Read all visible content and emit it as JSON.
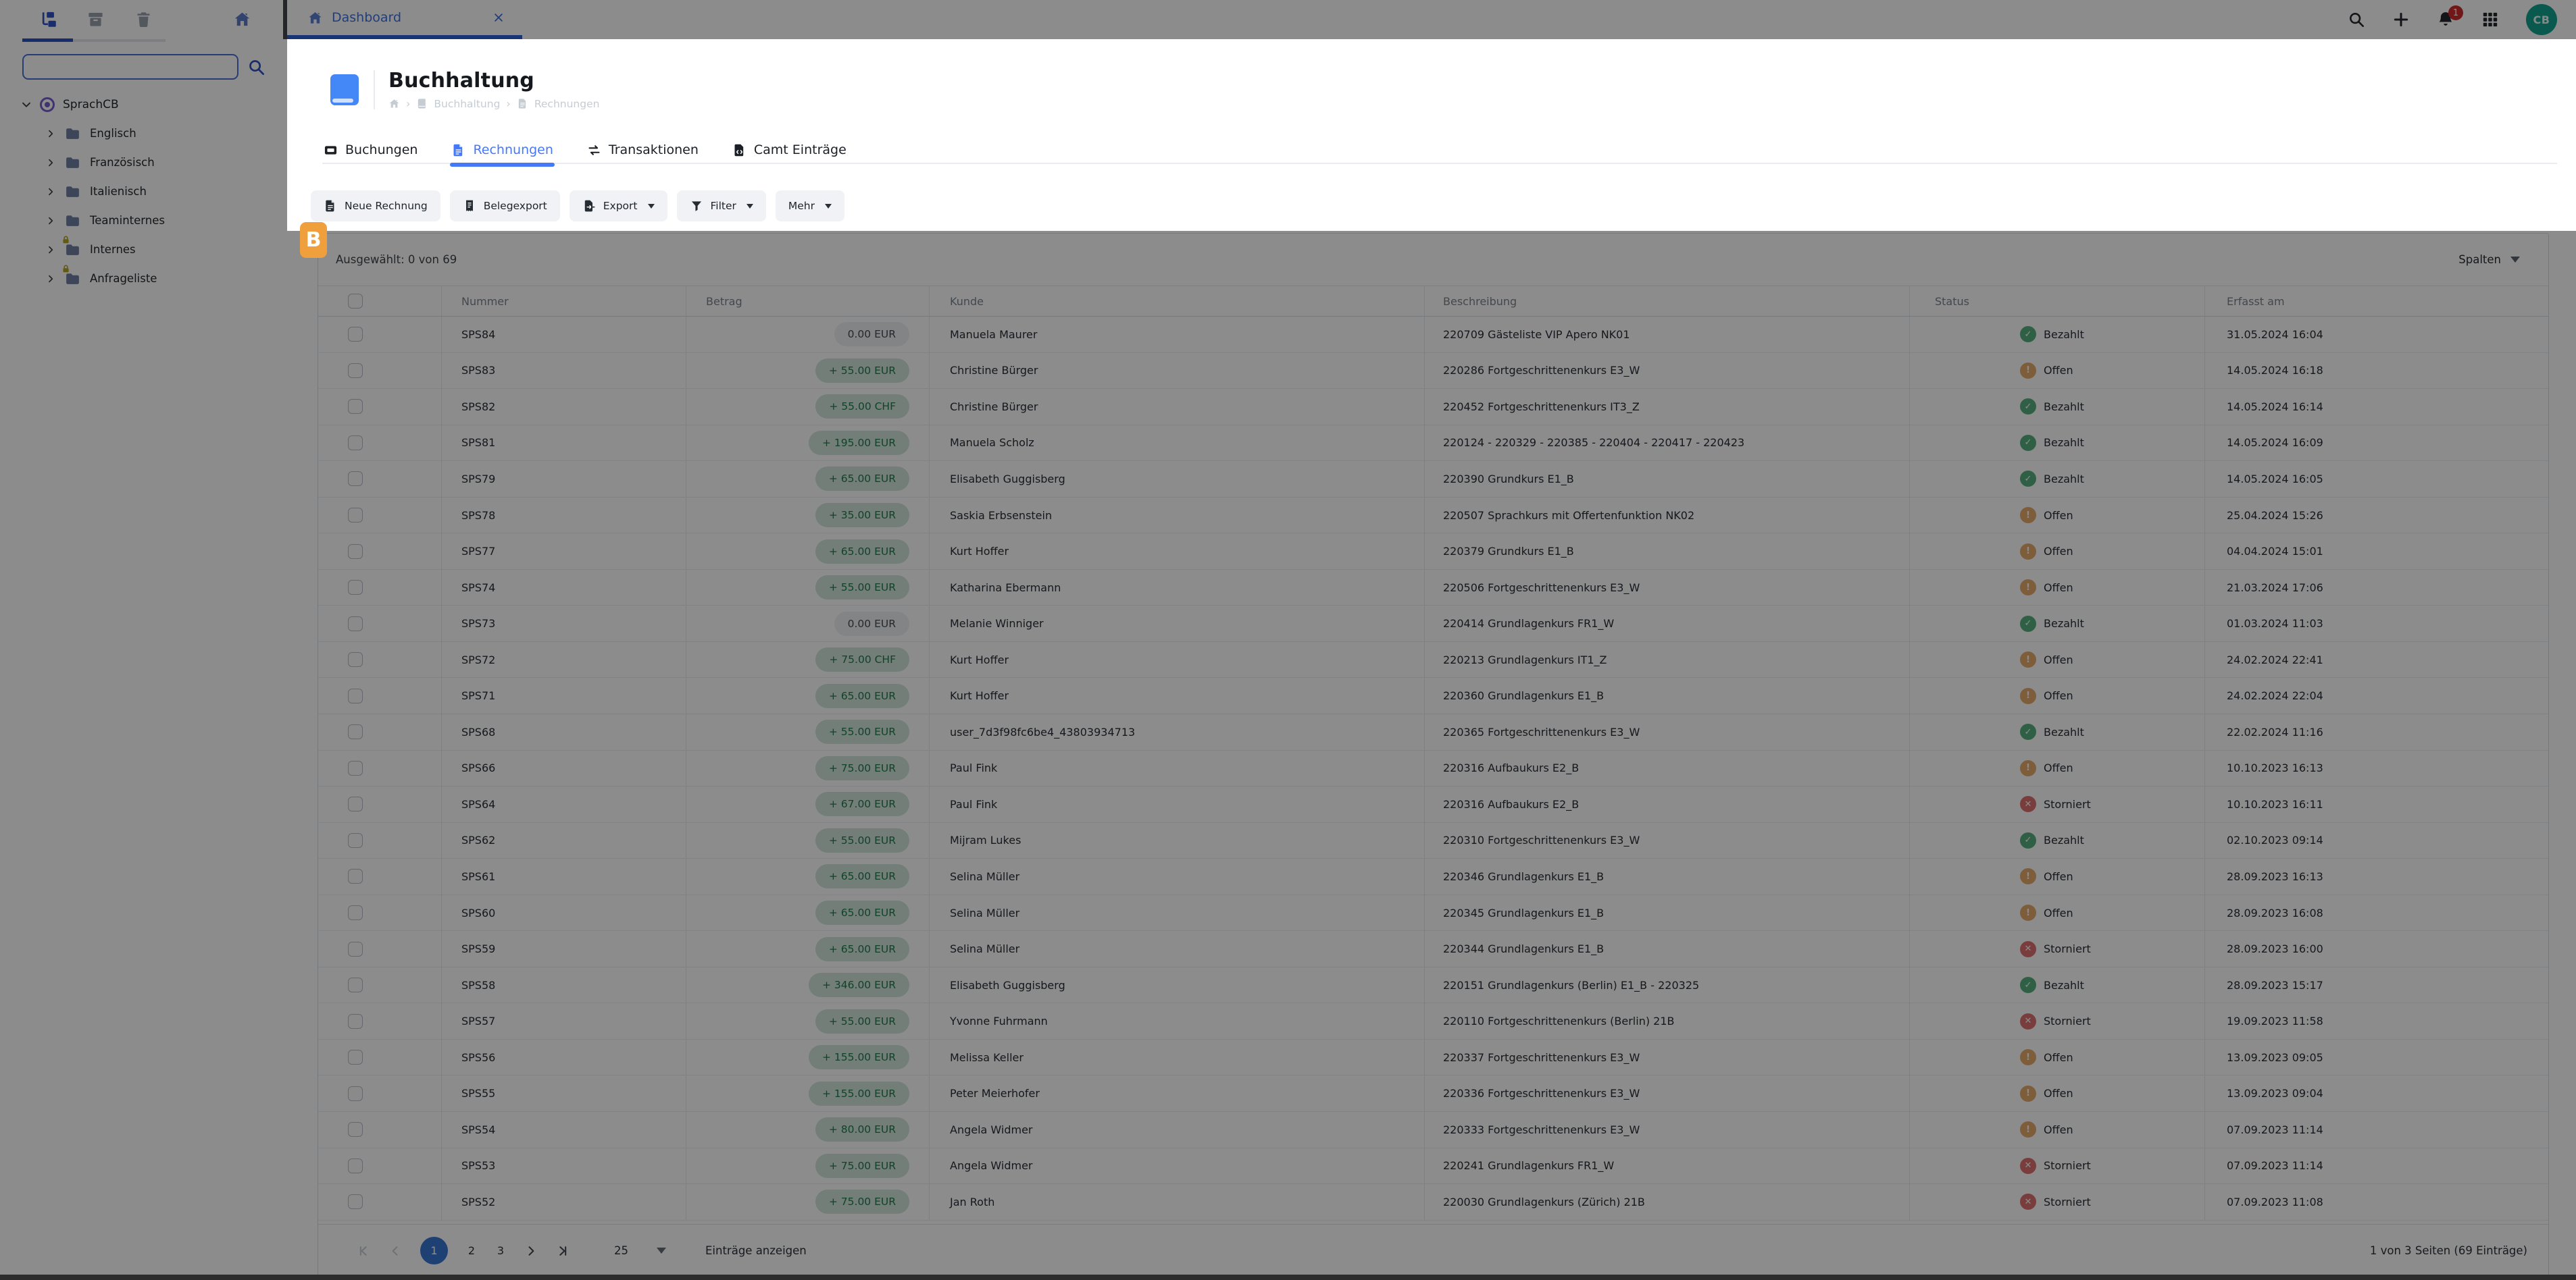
{
  "topbar": {
    "tab": {
      "label": "Dashboard"
    },
    "action_icons": [
      "search",
      "add",
      "notifications",
      "apps"
    ],
    "notification_count": "1",
    "avatar": "CB"
  },
  "sidebar": {
    "toolbar_icons": [
      "tree-structure",
      "archive",
      "trash",
      "home"
    ],
    "search": {
      "value": "",
      "placeholder": ""
    },
    "tree": {
      "root": {
        "label": "SprachCB"
      },
      "items": [
        {
          "label": "Englisch",
          "locked": false
        },
        {
          "label": "Französisch",
          "locked": false
        },
        {
          "label": "Italienisch",
          "locked": false
        },
        {
          "label": "Teaminternes",
          "locked": false
        },
        {
          "label": "Internes",
          "locked": true
        },
        {
          "label": "Anfrageliste",
          "locked": true
        }
      ]
    }
  },
  "page": {
    "title": "Buchhaltung",
    "breadcrumb": [
      "Buchhaltung",
      "Rechnungen"
    ],
    "breadcrumb_separator": "›"
  },
  "tabs": [
    {
      "label": "Buchungen",
      "icon": "ticket",
      "active": false
    },
    {
      "label": "Rechnungen",
      "icon": "invoice",
      "active": true
    },
    {
      "label": "Transaktionen",
      "icon": "transfer",
      "active": false
    },
    {
      "label": "Camt Einträge",
      "icon": "file-code",
      "active": false
    }
  ],
  "toolbar": [
    {
      "label": "Neue Rechnung",
      "icon": "invoice",
      "dropdown": false
    },
    {
      "label": "Belegexport",
      "icon": "receipt",
      "dropdown": false
    },
    {
      "label": "Export",
      "icon": "export",
      "dropdown": true
    },
    {
      "label": "Filter",
      "icon": "funnel",
      "dropdown": true
    },
    {
      "label": "Mehr",
      "icon": "",
      "dropdown": true
    }
  ],
  "panel": {
    "selected_summary": "Ausgewählt: 0 von 69",
    "columns_button": "Spalten"
  },
  "table": {
    "headers": [
      "Nummer",
      "Betrag",
      "Kunde",
      "Beschreibung",
      "Status",
      "Erfasst am"
    ],
    "rows": [
      {
        "nummer": "SPS84",
        "betrag": "0.00 EUR",
        "kind": "zero",
        "kunde": "Manuela Maurer",
        "beschreibung": "220709 Gästeliste VIP Apero NK01",
        "status": "Bezahlt",
        "erfasst": "31.05.2024 16:04"
      },
      {
        "nummer": "SPS83",
        "betrag": "+ 55.00 EUR",
        "kind": "pos",
        "kunde": "Christine Bürger",
        "beschreibung": "220286 Fortgeschrittenenkurs E3_W",
        "status": "Offen",
        "erfasst": "14.05.2024 16:18"
      },
      {
        "nummer": "SPS82",
        "betrag": "+ 55.00 CHF",
        "kind": "pos",
        "kunde": "Christine Bürger",
        "beschreibung": "220452 Fortgeschrittenenkurs IT3_Z",
        "status": "Bezahlt",
        "erfasst": "14.05.2024 16:14"
      },
      {
        "nummer": "SPS81",
        "betrag": "+ 195.00 EUR",
        "kind": "pos",
        "kunde": "Manuela Scholz",
        "beschreibung": "220124 - 220329 - 220385 - 220404 - 220417 - 220423",
        "status": "Bezahlt",
        "erfasst": "14.05.2024 16:09"
      },
      {
        "nummer": "SPS79",
        "betrag": "+ 65.00 EUR",
        "kind": "pos",
        "kunde": "Elisabeth Guggisberg",
        "beschreibung": "220390 Grundkurs E1_B",
        "status": "Bezahlt",
        "erfasst": "14.05.2024 16:05"
      },
      {
        "nummer": "SPS78",
        "betrag": "+ 35.00 EUR",
        "kind": "pos",
        "kunde": "Saskia Erbsenstein",
        "beschreibung": "220507 Sprachkurs mit Offertenfunktion NK02",
        "status": "Offen",
        "erfasst": "25.04.2024 15:26"
      },
      {
        "nummer": "SPS77",
        "betrag": "+ 65.00 EUR",
        "kind": "pos",
        "kunde": "Kurt Hoffer",
        "beschreibung": "220379 Grundkurs E1_B",
        "status": "Offen",
        "erfasst": "04.04.2024 15:01"
      },
      {
        "nummer": "SPS74",
        "betrag": "+ 55.00 EUR",
        "kind": "pos",
        "kunde": "Katharina Ebermann",
        "beschreibung": "220506 Fortgeschrittenenkurs E3_W",
        "status": "Offen",
        "erfasst": "21.03.2024 17:06"
      },
      {
        "nummer": "SPS73",
        "betrag": "0.00 EUR",
        "kind": "zero",
        "kunde": "Melanie Winniger",
        "beschreibung": "220414 Grundlagenkurs FR1_W",
        "status": "Bezahlt",
        "erfasst": "01.03.2024 11:03"
      },
      {
        "nummer": "SPS72",
        "betrag": "+ 75.00 CHF",
        "kind": "pos",
        "kunde": "Kurt Hoffer",
        "beschreibung": "220213 Grundlagenkurs IT1_Z",
        "status": "Offen",
        "erfasst": "24.02.2024 22:41"
      },
      {
        "nummer": "SPS71",
        "betrag": "+ 65.00 EUR",
        "kind": "pos",
        "kunde": "Kurt Hoffer",
        "beschreibung": "220360 Grundlagenkurs E1_B",
        "status": "Offen",
        "erfasst": "24.02.2024 22:04"
      },
      {
        "nummer": "SPS68",
        "betrag": "+ 55.00 EUR",
        "kind": "pos",
        "kunde": "user_7d3f98fc6be4_43803934713",
        "beschreibung": "220365 Fortgeschrittenenkurs E3_W",
        "status": "Bezahlt",
        "erfasst": "22.02.2024 11:16"
      },
      {
        "nummer": "SPS66",
        "betrag": "+ 75.00 EUR",
        "kind": "pos",
        "kunde": "Paul Fink",
        "beschreibung": "220316 Aufbaukurs E2_B",
        "status": "Offen",
        "erfasst": "10.10.2023 16:13"
      },
      {
        "nummer": "SPS64",
        "betrag": "+ 67.00 EUR",
        "kind": "pos",
        "kunde": "Paul Fink",
        "beschreibung": "220316 Aufbaukurs E2_B",
        "status": "Storniert",
        "erfasst": "10.10.2023 16:11"
      },
      {
        "nummer": "SPS62",
        "betrag": "+ 55.00 EUR",
        "kind": "pos",
        "kunde": "Mijram Lukes",
        "beschreibung": "220310 Fortgeschrittenenkurs E3_W",
        "status": "Bezahlt",
        "erfasst": "02.10.2023 09:14"
      },
      {
        "nummer": "SPS61",
        "betrag": "+ 65.00 EUR",
        "kind": "pos",
        "kunde": "Selina Müller",
        "beschreibung": "220346 Grundlagenkurs E1_B",
        "status": "Offen",
        "erfasst": "28.09.2023 16:13"
      },
      {
        "nummer": "SPS60",
        "betrag": "+ 65.00 EUR",
        "kind": "pos",
        "kunde": "Selina Müller",
        "beschreibung": "220345 Grundlagenkurs E1_B",
        "status": "Offen",
        "erfasst": "28.09.2023 16:08"
      },
      {
        "nummer": "SPS59",
        "betrag": "+ 65.00 EUR",
        "kind": "pos",
        "kunde": "Selina Müller",
        "beschreibung": "220344 Grundlagenkurs E1_B",
        "status": "Storniert",
        "erfasst": "28.09.2023 16:00"
      },
      {
        "nummer": "SPS58",
        "betrag": "+ 346.00 EUR",
        "kind": "pos",
        "kunde": "Elisabeth Guggisberg",
        "beschreibung": "220151 Grundlagenkurs (Berlin) E1_B - 220325",
        "status": "Bezahlt",
        "erfasst": "28.09.2023 15:17"
      },
      {
        "nummer": "SPS57",
        "betrag": "+ 55.00 EUR",
        "kind": "pos",
        "kunde": "Yvonne Fuhrmann",
        "beschreibung": "220110 Fortgeschrittenenkurs (Berlin) 21B",
        "status": "Storniert",
        "erfasst": "19.09.2023 11:58"
      },
      {
        "nummer": "SPS56",
        "betrag": "+ 155.00 EUR",
        "kind": "pos",
        "kunde": "Melissa Keller",
        "beschreibung": "220337 Fortgeschrittenenkurs E3_W",
        "status": "Offen",
        "erfasst": "13.09.2023 09:05"
      },
      {
        "nummer": "SPS55",
        "betrag": "+ 155.00 EUR",
        "kind": "pos",
        "kunde": "Peter Meierhofer",
        "beschreibung": "220336 Fortgeschrittenenkurs E3_W",
        "status": "Offen",
        "erfasst": "13.09.2023 09:04"
      },
      {
        "nummer": "SPS54",
        "betrag": "+ 80.00 EUR",
        "kind": "pos",
        "kunde": "Angela Widmer",
        "beschreibung": "220333 Fortgeschrittenenkurs E3_W",
        "status": "Offen",
        "erfasst": "07.09.2023 11:14"
      },
      {
        "nummer": "SPS53",
        "betrag": "+ 75.00 EUR",
        "kind": "pos",
        "kunde": "Angela Widmer",
        "beschreibung": "220241 Grundlagenkurs FR1_W",
        "status": "Storniert",
        "erfasst": "07.09.2023 11:14"
      },
      {
        "nummer": "SPS52",
        "betrag": "+ 75.00 EUR",
        "kind": "pos",
        "kunde": "Jan Roth",
        "beschreibung": "220030 Grundlagenkurs (Zürich) 21B",
        "status": "Storniert",
        "erfasst": "07.09.2023 11:08"
      }
    ]
  },
  "status_styles": {
    "Bezahlt": {
      "glyph": "✓",
      "color": "#56b07e"
    },
    "Offen": {
      "glyph": "!",
      "color": "#e5a96c"
    },
    "Storniert": {
      "glyph": "✕",
      "color": "#df7070"
    }
  },
  "pagination": {
    "pages": [
      "1",
      "2",
      "3"
    ],
    "current": "1",
    "page_size": "25",
    "page_size_label": "Einträge anzeigen",
    "summary": "1 von 3 Seiten (69 Einträge)"
  },
  "annotation": {
    "label": "B"
  },
  "colors": {
    "accent_blue": "#4678f7",
    "paid_green": "#56b07e",
    "open_orange": "#e5a96c",
    "cancelled_red": "#df7070",
    "amount_pill_bg": "#cfe6d9",
    "amount_pill_text": "#1e7a4d",
    "avatar_teal": "#12a390",
    "annotation_orange": "#efa03d",
    "notification_red": "#cf2b2b"
  }
}
